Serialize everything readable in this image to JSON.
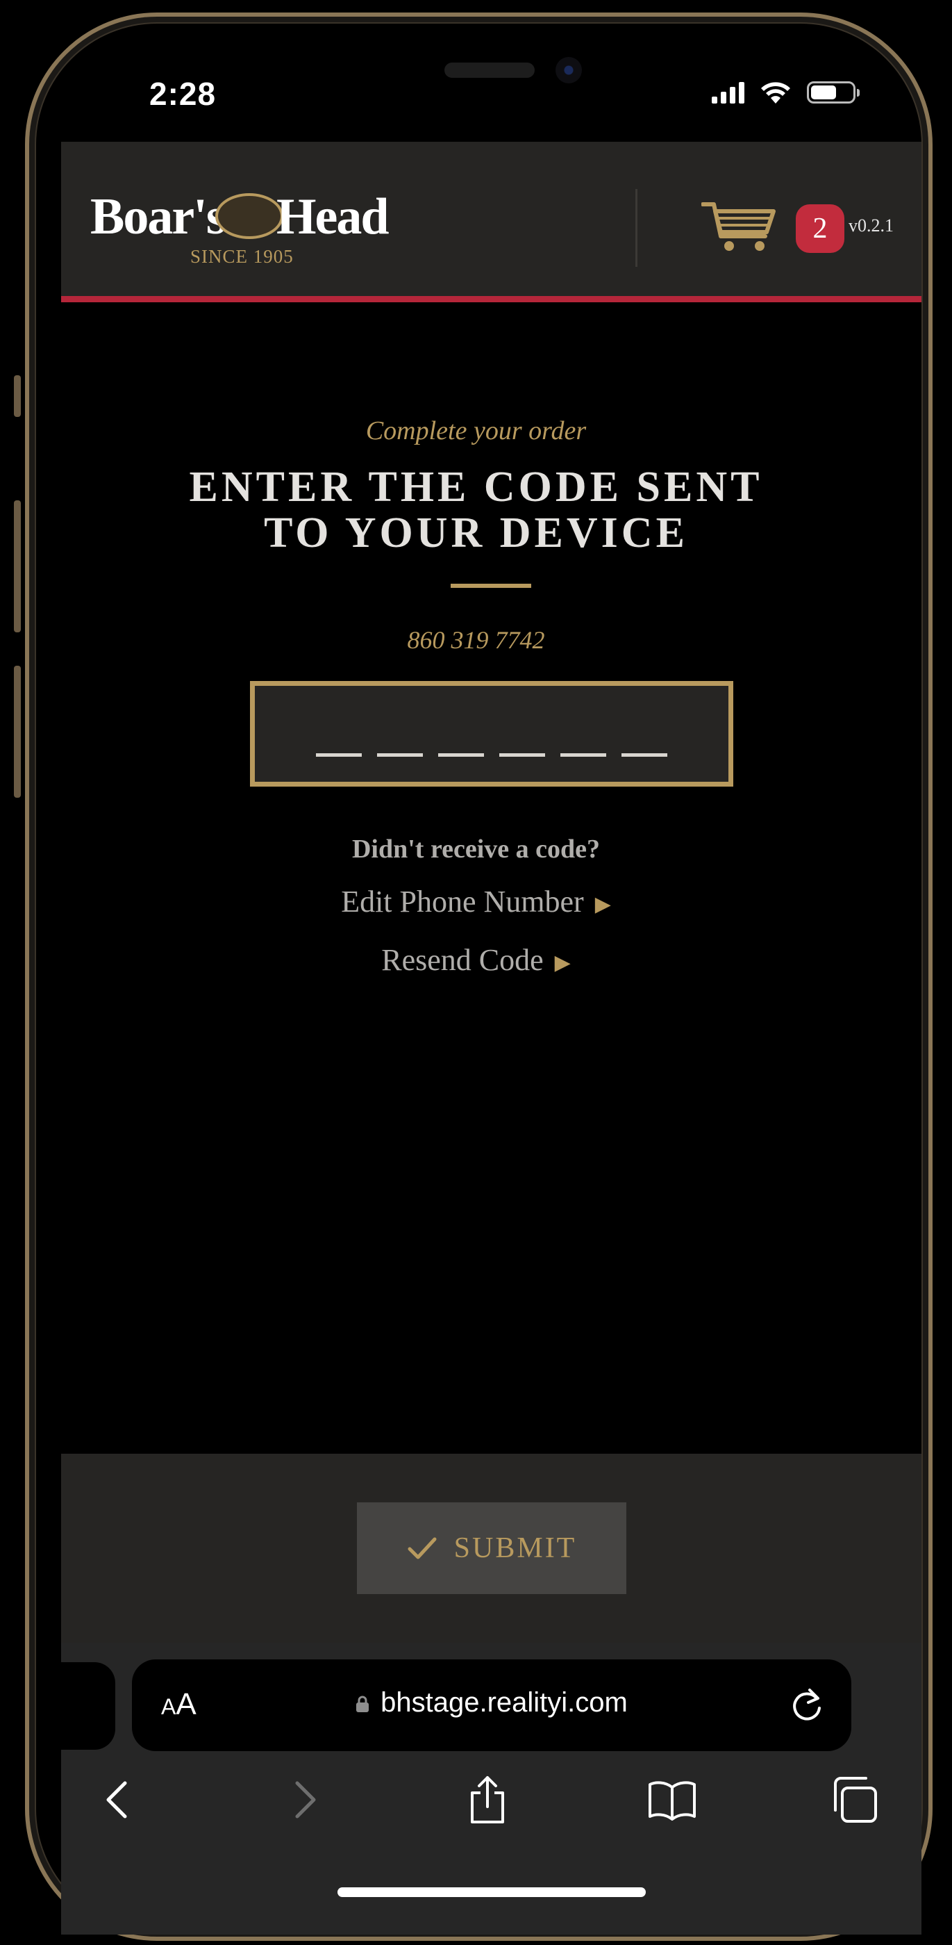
{
  "status_bar": {
    "time": "2:28"
  },
  "header": {
    "logo_name_left": "Boar's",
    "logo_name_right": "Head",
    "logo_since": "SINCE 1905",
    "cart_count": "2",
    "version": "v0.2.1"
  },
  "main": {
    "subheading": "Complete your order",
    "heading_line1": "ENTER THE CODE SENT",
    "heading_line2": "TO YOUR DEVICE",
    "phone_number": "860 319 7742",
    "code_length": 6,
    "didnt_receive": "Didn't receive a code?",
    "edit_phone_label": "Edit Phone Number",
    "resend_label": "Resend Code"
  },
  "footer": {
    "submit_label": "SUBMIT"
  },
  "browser": {
    "aa_label_small": "A",
    "aa_label_large": "A",
    "url": "bhstage.realityi.com"
  },
  "colors": {
    "gold": "#b89a5e",
    "brand_red": "#c22c3d",
    "header_bg": "#262523"
  },
  "icons": [
    "cart-icon",
    "check-icon",
    "lock-icon",
    "reload-icon",
    "back-icon",
    "forward-icon",
    "share-icon",
    "bookmarks-icon",
    "tabs-icon",
    "arrow-right-icon"
  ]
}
